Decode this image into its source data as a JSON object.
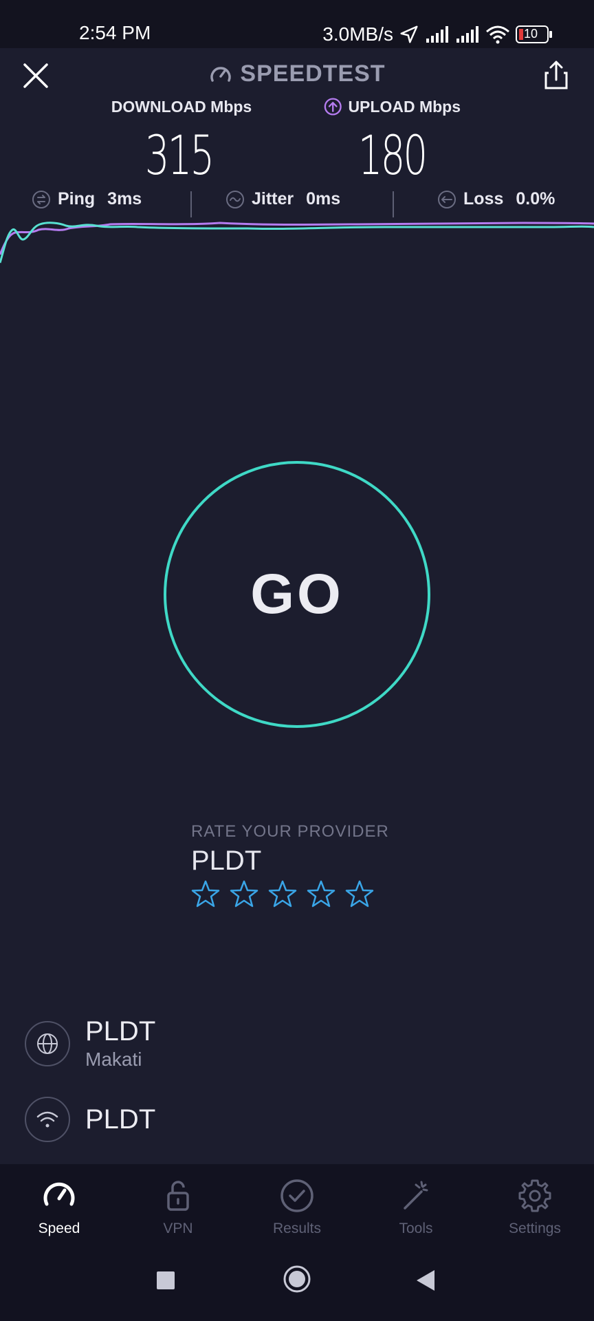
{
  "status_bar": {
    "time": "2:54 PM",
    "net_speed": "3.0MB/s",
    "battery": "10"
  },
  "header": {
    "title": "SPEEDTEST"
  },
  "results": {
    "download_label": "DOWNLOAD Mbps",
    "download_value": "315",
    "upload_label": "UPLOAD Mbps",
    "upload_value": "180"
  },
  "metrics": {
    "ping_label": "Ping",
    "ping_value": "3ms",
    "jitter_label": "Jitter",
    "jitter_value": "0ms",
    "loss_label": "Loss",
    "loss_value": "0.0%"
  },
  "go_button": {
    "label": "GO"
  },
  "rate": {
    "title": "RATE YOUR PROVIDER",
    "provider": "PLDT",
    "stars_max": 5
  },
  "server": {
    "provider": "PLDT",
    "location": "Makati"
  },
  "connection": {
    "name": "PLDT"
  },
  "nav": {
    "items": [
      {
        "label": "Speed",
        "active": true
      },
      {
        "label": "VPN",
        "active": false
      },
      {
        "label": "Results",
        "active": false
      },
      {
        "label": "Tools",
        "active": false
      },
      {
        "label": "Settings",
        "active": false
      }
    ]
  },
  "colors": {
    "background": "#1c1d2e",
    "download": "#3fd9c6",
    "upload": "#b57cf0",
    "go_ring": "#3fd9c6",
    "star": "#3aa6e8"
  }
}
